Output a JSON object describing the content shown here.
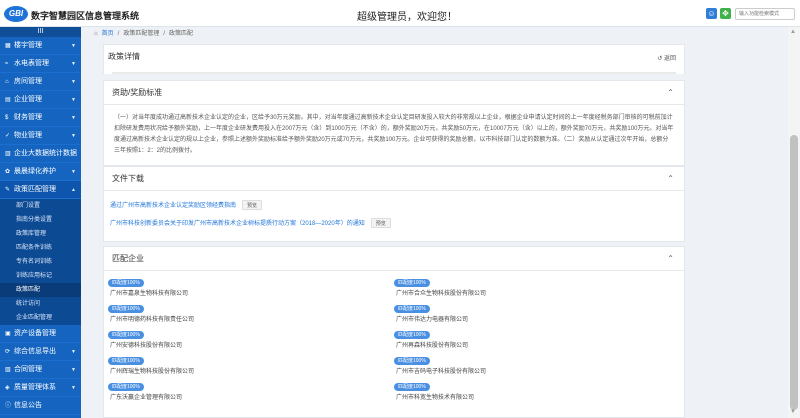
{
  "header": {
    "logo_text": "GBI",
    "app_title": "数字智慧园区信息管理系统",
    "welcome": "超级管理员，欢迎您！",
    "search_placeholder": "输入功能检索模式"
  },
  "sidebar": {
    "collapse_label": "III",
    "menus": [
      {
        "icon": "▦",
        "label": "楼宇管理",
        "arrow": "▼"
      },
      {
        "icon": "≈",
        "label": "水电表管理",
        "arrow": "▼"
      },
      {
        "icon": "⌂",
        "label": "房间管理",
        "arrow": "▼"
      },
      {
        "icon": "▤",
        "label": "企业管理",
        "arrow": "▼"
      },
      {
        "icon": "$",
        "label": "财务管理",
        "arrow": "▼"
      },
      {
        "icon": "✓",
        "label": "物业管理",
        "arrow": "▼"
      },
      {
        "icon": "▥",
        "label": "企业大数据统计数据",
        "arrow": ""
      },
      {
        "icon": "✿",
        "label": "晨晨绿化养护",
        "arrow": "▼"
      },
      {
        "icon": "✎",
        "label": "政策匹配管理",
        "arrow": "▲"
      }
    ],
    "subitems": [
      "部门设置",
      "指南分类设置",
      "政策库管理",
      "匹配条件训练",
      "专有名词训练",
      "训练应用标记",
      "政策匹配",
      "统计访问",
      "企业匹配管理"
    ],
    "menus_after": [
      {
        "icon": "▣",
        "label": "资产设备管理",
        "arrow": ""
      },
      {
        "icon": "⟳",
        "label": "综合信息导出",
        "arrow": "▼"
      },
      {
        "icon": "▧",
        "label": "合同管理",
        "arrow": "▼"
      },
      {
        "icon": "◈",
        "label": "质量管理体系",
        "arrow": "▼"
      },
      {
        "icon": "ⓘ",
        "label": "信息公告",
        "arrow": ""
      },
      {
        "icon": "▨",
        "label": "题库问答",
        "arrow": ""
      }
    ]
  },
  "breadcrumb": [
    "首页",
    "政策匹配管理",
    "政策匹配"
  ],
  "detail": {
    "title": "政策详情",
    "back_label": "返回"
  },
  "reward_section": {
    "title": "资助/奖励标准",
    "text": "（一）对当年度成功通过高新技术企业认定的企业，区给予30万元奖励。其中，对当年度通过高新技术企业认定目研发投入较大的非常规以上企业，根据企业申请认定时间的上一年度经税务部门审核的可税前加计扣除研发费用状况给予额外奖励，上一年度企业研发费用投入在2007万元（含）到1000万元（不含）的，额外奖励20万元，共奖励50万元，在10007万元（含）以上的，额外奖励70万元，共奖励100万元。对当年度通过高新技术企业认定的规以上企业，参照上述额外奖励标准给予额外奖励20万元或70万元，共奖励100万元。企业可获得的奖励总额，以市科技部门认定的数额为准。（二）奖励从认定通过次年开始，总额分三年按照1：2：2的比例拨付。"
  },
  "file_section": {
    "title": "文件下载",
    "files": [
      {
        "name": "通过广州市高新技术企业认定奖励区领经费指南",
        "action": "预览"
      },
      {
        "name": "广州市科技创新委员会关于印发广州市高新技术企业树标提质行动方案（2018—2020年）的通知",
        "action": "预览"
      }
    ]
  },
  "match_section": {
    "title": "匹配企业",
    "companies": [
      {
        "badge": "匹配度100%",
        "name": "广州市嘉泉生物科技有限公司"
      },
      {
        "badge": "匹配度100%",
        "name": "广州市合众生物科技股份有限公司"
      },
      {
        "badge": "匹配度100%",
        "name": "广州市明德药科技有限责任公司"
      },
      {
        "badge": "匹配度100%",
        "name": "广州市伟达力电器有限公司"
      },
      {
        "badge": "匹配度100%",
        "name": "广州安德科技股份有限公司"
      },
      {
        "badge": "匹配度100%",
        "name": "广州再森科技股份有限公司"
      },
      {
        "badge": "匹配度100%",
        "name": "广州辉瑞生物科技股份有限公司"
      },
      {
        "badge": "匹配度100%",
        "name": "广州市吉码电子科技股份有限公司"
      },
      {
        "badge": "匹配度100%",
        "name": "广东沃赢企业管理有限公司"
      },
      {
        "badge": "匹配度100%",
        "name": "广州市科宽生物技术有限公司"
      }
    ]
  },
  "colors": {
    "sidebar": "#1565c0",
    "accent": "#1e73d8",
    "badge": "#4a90e2"
  }
}
